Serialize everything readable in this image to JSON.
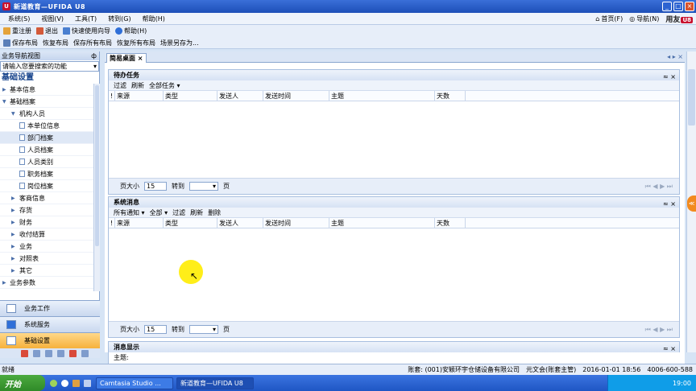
{
  "window": {
    "title": "新道教育—UFIDA U8",
    "min": "_",
    "max": "□",
    "close": "×"
  },
  "menu": [
    "系统(S)",
    "视图(V)",
    "工具(T)",
    "转到(G)",
    "帮助(H)"
  ],
  "top_right": {
    "home": "首页(F)",
    "navigate": "导航(N)",
    "brand": "用友",
    "brand_tag": "U8"
  },
  "toolbar1": [
    "重注册",
    "退出",
    "快速使用向导",
    "帮助(H)"
  ],
  "toolbar2": [
    "保存布局",
    "恢复布局",
    "保存所有布局",
    "恢复所有布局",
    "场景另存为..."
  ],
  "nav": {
    "header": "业务导航视图",
    "pin": "ф",
    "search_placeholder": "请输入您要搜索的功能",
    "section": "基础设置",
    "tree": [
      {
        "label": "基本信息",
        "level": 0,
        "arrow": "▶"
      },
      {
        "label": "基础档案",
        "level": 0,
        "arrow": "▼"
      },
      {
        "label": "机构人员",
        "level": 1,
        "arrow": "▼"
      },
      {
        "label": "本单位信息",
        "level": 2,
        "arrow": ""
      },
      {
        "label": "部门档案",
        "level": 2,
        "arrow": ""
      },
      {
        "label": "人员档案",
        "level": 2,
        "arrow": ""
      },
      {
        "label": "人员类别",
        "level": 2,
        "arrow": ""
      },
      {
        "label": "职务档案",
        "level": 2,
        "arrow": ""
      },
      {
        "label": "岗位档案",
        "level": 2,
        "arrow": ""
      },
      {
        "label": "客商信息",
        "level": 1,
        "arrow": "▶"
      },
      {
        "label": "存货",
        "level": 1,
        "arrow": "▶"
      },
      {
        "label": "财务",
        "level": 1,
        "arrow": "▶"
      },
      {
        "label": "收付结算",
        "level": 1,
        "arrow": "▶"
      },
      {
        "label": "业务",
        "level": 1,
        "arrow": "▶"
      },
      {
        "label": "对照表",
        "level": 1,
        "arrow": "▶"
      },
      {
        "label": "其它",
        "level": 1,
        "arrow": "▶"
      },
      {
        "label": "业务参数",
        "level": 0,
        "arrow": "▶"
      }
    ],
    "outlook": [
      "业务工作",
      "系统服务",
      "基础设置"
    ]
  },
  "main": {
    "tab": "简易桌面",
    "tab_close": "×",
    "todo": {
      "title": "待办任务",
      "toolbar": [
        "过滤",
        "刷新",
        "全部任务 ▾"
      ],
      "columns": [
        "!",
        "来源",
        "类型",
        "发送人",
        "发送时间",
        "主题",
        "天数"
      ]
    },
    "sysmsg": {
      "title": "系统消息",
      "toolbar": [
        "所有通知 ▾",
        "全部 ▾",
        "过滤",
        "刷新",
        "删除"
      ],
      "columns": [
        "!",
        "来源",
        "类型",
        "发送人",
        "发送时间",
        "主题",
        "天数"
      ]
    },
    "pager": {
      "size_label": "页大小",
      "size": "15",
      "goto_label": "转到",
      "page_label": "页"
    },
    "msgview": {
      "title": "消息显示",
      "subject_label": "主题:"
    },
    "panel_ctl": "≈  ×"
  },
  "status": {
    "left": "就绪",
    "account": "账套: (001)安颖环宇仓储设备有限公司",
    "user": "元文会(账套主管)",
    "date": "2016-01-01 18:56",
    "phone": "4006-600-588"
  },
  "taskbar": {
    "start": "开始",
    "items": [
      "Camtasia Studio ...",
      "新道教育—UFIDA U8"
    ],
    "clock": "19:00"
  }
}
